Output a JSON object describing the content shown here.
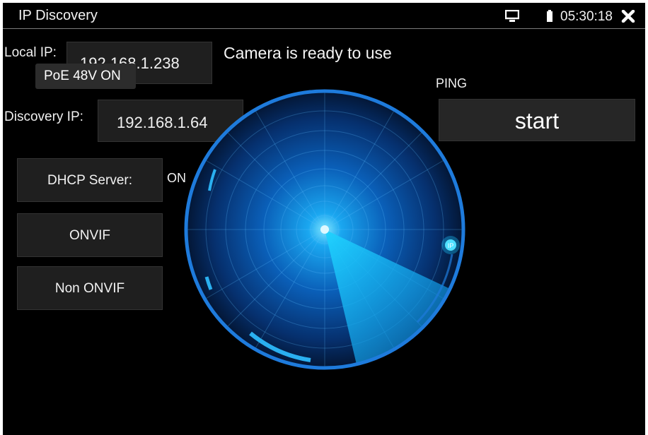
{
  "titlebar": {
    "title": "IP Discovery",
    "clock": "05:30:18",
    "icons": [
      "monitor-icon",
      "battery-icon",
      "close-icon"
    ]
  },
  "local_ip": {
    "label": "Local IP:",
    "value": "192.168.1.238"
  },
  "poe": {
    "label": "PoE 48V ON"
  },
  "status": {
    "message": "Camera is ready to use"
  },
  "ping": {
    "label": "PING",
    "button": "start"
  },
  "discovery_ip": {
    "label": "Discovery IP:",
    "value": "192.168.1.64"
  },
  "dhcp": {
    "button": "DHCP Server:",
    "state": "ON"
  },
  "buttons": {
    "onvif": "ONVIF",
    "non_onvif": "Non ONVIF"
  },
  "radar": {
    "blip_label": "IP"
  },
  "colors": {
    "radar_ring": "#1e7bdc",
    "radar_glow": "#22b8ff",
    "panel": "#1f1f1f"
  }
}
